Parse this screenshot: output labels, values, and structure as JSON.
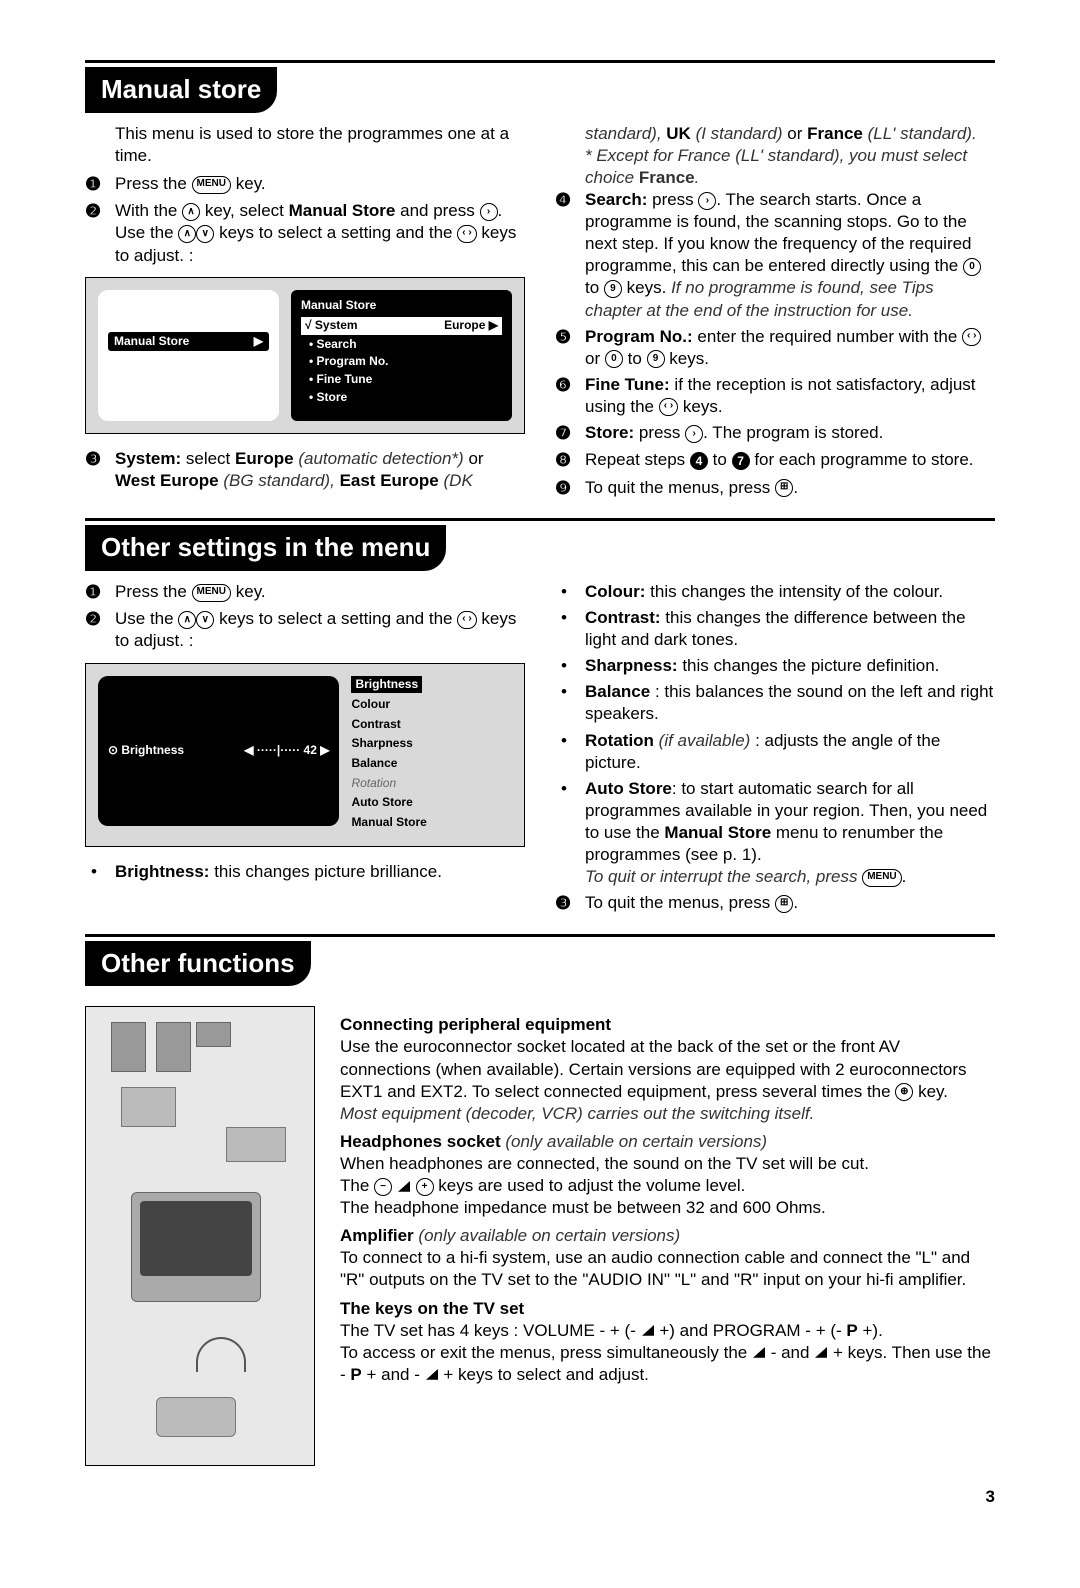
{
  "page_number": "3",
  "sections": {
    "manual_store": {
      "title": "Manual store",
      "intro": "This menu is used to store the programmes one at a time.",
      "left_steps": {
        "s1": "Press the",
        "s1b": "key.",
        "s2a": "With the",
        "s2b": "key, select",
        "s2c": "Manual Store",
        "s2d": "and press",
        "s2e": ". Use the",
        "s2f": "keys to select a setting and the",
        "s2g": "keys to adjust. :",
        "s3a": "System:",
        "s3b": "select",
        "s3c": "Europe",
        "s3d": "(automatic detection*)",
        "s3e": "or",
        "s3f": "West Europe",
        "s3g": "(BG standard),",
        "s3h": "East Europe",
        "s3i": "(DK"
      },
      "menu_fig": {
        "left_label": "Manual Store",
        "right_title": "Manual Store",
        "row_label": "√ System",
        "row_value": "Europe ▶",
        "items": [
          "• Search",
          "• Program No.",
          "• Fine Tune",
          "• Store"
        ]
      },
      "right_col": {
        "rtop1": "standard),",
        "rtop2": "UK",
        "rtop3": "(I standard)",
        "rtop4": "or",
        "rtop5": "France",
        "rtop6": "(LL' standard).",
        "rnote": "* Except for France (LL' standard), you must select choice",
        "rnote_b": "France",
        "s4a": "Search:",
        "s4b": "press",
        "s4c": ". The search starts. Once a programme is found, the scanning stops. Go to the next step. If you know the frequency of the required programme, this can be entered directly using the",
        "s4d": "to",
        "s4e": "keys.",
        "s4f": "If no programme is found, see Tips chapter at the end of the instruction for use.",
        "s5a": "Program No.:",
        "s5b": "enter the required number with the",
        "s5c": "or",
        "s5d": "to",
        "s5e": "keys.",
        "s6a": "Fine Tune:",
        "s6b": "if the reception is not satisfactory, adjust using the",
        "s6c": "keys.",
        "s7a": "Store:",
        "s7b": "press",
        "s7c": ". The program is stored.",
        "s8a": "Repeat steps",
        "s8b": "to",
        "s8c": "for each programme to store.",
        "s9": "To quit the menus, press"
      }
    },
    "other_settings": {
      "title": "Other settings in the menu",
      "left": {
        "s1": "Press the",
        "s1b": "key.",
        "s2a": "Use the",
        "s2b": "keys to select a setting and the",
        "s2c": "keys to adjust. :",
        "brightness_note_a": "Brightness:",
        "brightness_note_b": "this changes picture brilliance."
      },
      "pic_fig": {
        "row_label": "⊙ Brightness",
        "row_value": "42",
        "list": {
          "sel": "Brightness",
          "i1": "Colour",
          "i2": "Contrast",
          "i3": "Sharpness",
          "i4": "Balance",
          "i5": "Rotation",
          "i6": "Auto Store",
          "i7": "Manual Store"
        }
      },
      "right": {
        "b1a": "Colour:",
        "b1b": "this changes the intensity of the colour.",
        "b2a": "Contrast:",
        "b2b": "this changes the difference between the light and dark tones.",
        "b3a": "Sharpness:",
        "b3b": "this changes the picture definition.",
        "b4a": "Balance",
        "b4b": ": this balances the sound on the left and right speakers.",
        "b5a": "Rotation",
        "b5b": "(if available)",
        "b5c": ": adjusts the angle of the picture.",
        "b6a": "Auto Store",
        "b6b": ": to start automatic search for all programmes available in your region. Then, you need to use the",
        "b6c": "Manual Store",
        "b6d": "menu to renumber the programmes (see p. 1).",
        "b6e": "To quit or interrupt the search, press",
        "s3": "To quit the menus, press"
      }
    },
    "other_functions": {
      "title": "Other functions",
      "h1": "Connecting peripheral equipment",
      "p1a": "Use the euroconnector socket located at the back of the set or the front AV connections (when available). Certain versions are equipped with 2 euroconnectors EXT1 and EXT2. To select connected equipment, press several times the",
      "p1b": "key.",
      "p1c": "Most equipment (decoder, VCR) carries out the switching itself.",
      "h2a": "Headphones socket",
      "h2b": "(only available on certain versions)",
      "p2a": "When headphones are connected, the sound on the TV set will be cut.",
      "p2b": "The",
      "p2c": "keys are used to adjust the volume level.",
      "p2d": "The headphone impedance must be between 32 and 600 Ohms.",
      "h3a": "Amplifier",
      "h3b": "(only available on certain versions)",
      "p3": "To connect to a hi-fi system, use an audio connection cable and connect the \"L\" and \"R\" outputs on the TV set to the \"AUDIO IN\" \"L\" and \"R\" input on your hi-fi amplifier.",
      "h4": "The keys on the TV set",
      "p4a": "The TV set has 4 keys : VOLUME - + (-",
      "p4b": "+) and PROGRAM - + (-",
      "p4c": "P",
      "p4d": "+).",
      "p4e": "To access or exit the menus, press simultaneously the",
      "p4f": "- and",
      "p4g": "+ keys. Then use the -",
      "p4h": "P",
      "p4i": "+ and -",
      "p4j": "+ keys to select and adjust."
    }
  },
  "keys": {
    "menu": "MENU",
    "up": "∧",
    "down": "∨",
    "right": "›",
    "left": "‹",
    "zero": "0",
    "nine": "9",
    "exit": "⊞",
    "source": "⊕",
    "minus": "−",
    "plus": "+"
  }
}
